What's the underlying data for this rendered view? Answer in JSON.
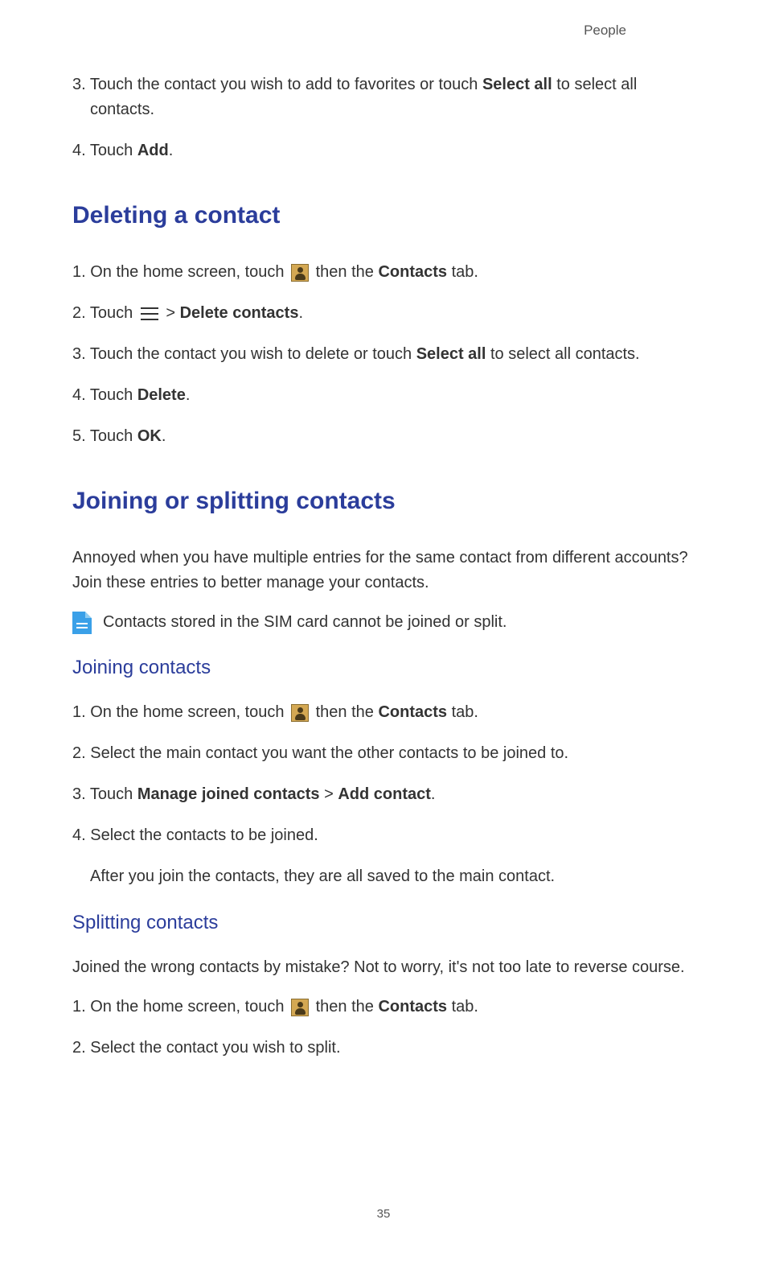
{
  "header": {
    "section": "People"
  },
  "intro_steps": [
    {
      "num": "3.",
      "pre": "Touch the contact you wish to add to favorites or touch ",
      "bold1": "Select all",
      "post": " to select all contacts."
    },
    {
      "num": "4.",
      "pre": "Touch ",
      "bold1": "Add",
      "post": "."
    }
  ],
  "section_delete": {
    "title": "Deleting a contact",
    "steps": {
      "s1_pre": "On the home screen, touch ",
      "s1_mid": " then the ",
      "s1_bold": "Contacts",
      "s1_post": " tab.",
      "s2_pre": "Touch ",
      "s2_gt": " > ",
      "s2_bold": "Delete contacts",
      "s2_post": ".",
      "s3_pre": "Touch the contact you wish to delete or touch ",
      "s3_bold": "Select all",
      "s3_post": " to select all contacts.",
      "s4_pre": "Touch ",
      "s4_bold": "Delete",
      "s4_post": ".",
      "s5_pre": "Touch ",
      "s5_bold": "OK",
      "s5_post": "."
    }
  },
  "section_join": {
    "title": "Joining or splitting contacts",
    "intro": "Annoyed when you have multiple entries for the same contact from different accounts? Join these entries to better manage your contacts.",
    "note": "Contacts stored in the SIM card cannot be joined or split.",
    "sub_joining": {
      "title": "Joining contacts",
      "s1_pre": "On the home screen, touch ",
      "s1_mid": " then the ",
      "s1_bold": "Contacts",
      "s1_post": " tab.",
      "s2": "Select the main contact you want the other contacts to be joined to.",
      "s3_pre": "Touch ",
      "s3_bold1": "Manage joined contacts",
      "s3_gt": " > ",
      "s3_bold2": "Add contact",
      "s3_post": ".",
      "s4": "Select the contacts to be joined.",
      "s4_note": "After you join the contacts, they are all saved to the main contact."
    },
    "sub_splitting": {
      "title": "Splitting contacts",
      "intro": "Joined the wrong contacts by mistake? Not to worry, it's not too late to reverse course.",
      "s1_pre": "On the home screen, touch ",
      "s1_mid": " then the ",
      "s1_bold": "Contacts",
      "s1_post": " tab.",
      "s2": "Select the contact you wish to split."
    }
  },
  "page_number": "35",
  "nums": {
    "n1": "1. ",
    "n2": "2. ",
    "n3": "3. ",
    "n4": "4. ",
    "n5": "5. "
  }
}
